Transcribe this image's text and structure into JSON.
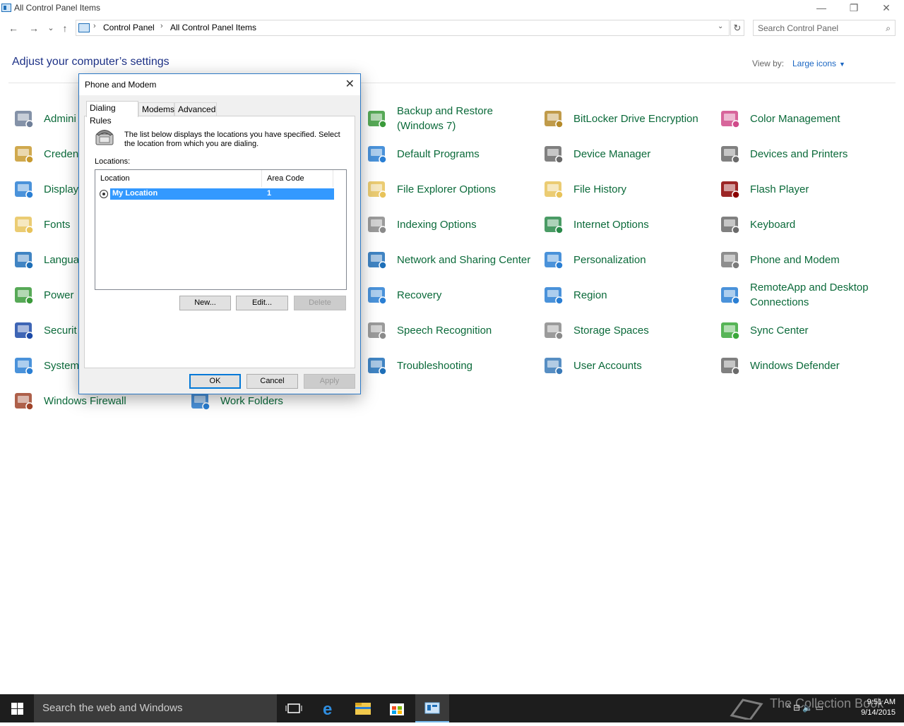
{
  "window": {
    "title": "All Control Panel Items",
    "min_glyph": "—",
    "restore_glyph": "❐",
    "close_glyph": "✕"
  },
  "nav": {
    "back_glyph": "←",
    "forward_glyph": "→",
    "recent_glyph": "⌄",
    "up_glyph": "↑",
    "sep_glyph": "›",
    "dropdown_glyph": "⌄",
    "refresh_glyph": "↻",
    "breadcrumb": [
      "Control Panel",
      "All Control Panel Items"
    ],
    "search_placeholder": "Search Control Panel",
    "search_glyph": "⌕"
  },
  "header": {
    "title": "Adjust your computer’s settings",
    "view_by_label": "View by:",
    "view_by_value": "Large icons",
    "view_by_caret": "▼"
  },
  "items": [
    {
      "label": "Admini",
      "icon": "administrative-tools-icon",
      "color": "#6f7f99"
    },
    {
      "label": "Creden",
      "icon": "credential-manager-icon",
      "color": "#c89a2f"
    },
    {
      "label": "Display",
      "icon": "display-icon",
      "color": "#2a7fd4"
    },
    {
      "label": "Fonts",
      "icon": "fonts-icon",
      "color": "#e8c35a"
    },
    {
      "label": "Langua",
      "icon": "language-icon",
      "color": "#1e6fb8"
    },
    {
      "label": "Power",
      "icon": "power-options-icon",
      "color": "#3a9a3a"
    },
    {
      "label": "Securit",
      "icon": "security-maintenance-icon",
      "color": "#1c4aa8"
    },
    {
      "label": "System",
      "icon": "system-icon",
      "color": "#2a7fd4"
    },
    {
      "label": "Windows Firewall",
      "icon": "firewall-icon",
      "color": "#a0442a"
    },
    {
      "label": "Work Folders",
      "icon": "work-folders-icon",
      "color": "#2a7fd4"
    },
    {
      "label": "Backup and Restore (Windows 7)",
      "icon": "backup-restore-icon",
      "color": "#3a9a3a"
    },
    {
      "label": "Default Programs",
      "icon": "default-programs-icon",
      "color": "#2a7fd4"
    },
    {
      "label": "File Explorer Options",
      "icon": "file-explorer-options-icon",
      "color": "#e8c35a"
    },
    {
      "label": "Indexing Options",
      "icon": "indexing-options-icon",
      "color": "#8a8a8a"
    },
    {
      "label": "Network and Sharing Center",
      "icon": "network-sharing-icon",
      "color": "#1e6fb8"
    },
    {
      "label": "Recovery",
      "icon": "recovery-icon",
      "color": "#2a7fd4"
    },
    {
      "label": "Speech Recognition",
      "icon": "microphone-icon",
      "color": "#8a8a8a"
    },
    {
      "label": "Troubleshooting",
      "icon": "troubleshooting-icon",
      "color": "#1e6fb8"
    },
    {
      "label": "BitLocker Drive Encryption",
      "icon": "bitlocker-icon",
      "color": "#b58a2a"
    },
    {
      "label": "Device Manager",
      "icon": "device-manager-icon",
      "color": "#6a6a6a"
    },
    {
      "label": "File History",
      "icon": "file-history-icon",
      "color": "#e8c35a"
    },
    {
      "label": "Internet Options",
      "icon": "internet-options-icon",
      "color": "#2a8a4a"
    },
    {
      "label": "Personalization",
      "icon": "personalization-icon",
      "color": "#2a7fd4"
    },
    {
      "label": "Region",
      "icon": "region-icon",
      "color": "#2a7fd4"
    },
    {
      "label": "Storage Spaces",
      "icon": "storage-spaces-icon",
      "color": "#8a8a8a"
    },
    {
      "label": "User Accounts",
      "icon": "user-accounts-icon",
      "color": "#3a7ab8"
    },
    {
      "label": "Color Management",
      "icon": "color-management-icon",
      "color": "#d04a8a"
    },
    {
      "label": "Devices and Printers",
      "icon": "devices-printers-icon",
      "color": "#6a6a6a"
    },
    {
      "label": "Flash Player",
      "icon": "flash-player-icon",
      "color": "#8b0000"
    },
    {
      "label": "Keyboard",
      "icon": "keyboard-icon",
      "color": "#6a6a6a"
    },
    {
      "label": "Phone and Modem",
      "icon": "phone-modem-icon",
      "color": "#7a7a7a"
    },
    {
      "label": "RemoteApp and Desktop Connections",
      "icon": "remoteapp-icon",
      "color": "#2a7fd4"
    },
    {
      "label": "Sync Center",
      "icon": "sync-center-icon",
      "color": "#3aa83a"
    },
    {
      "label": "Windows Defender",
      "icon": "windows-defender-icon",
      "color": "#6a6a6a"
    }
  ],
  "dialog": {
    "title": "Phone and Modem",
    "close_glyph": "✕",
    "tabs": [
      "Dialing Rules",
      "Modems",
      "Advanced"
    ],
    "description": "The list below displays the locations you have specified. Select the location from which you are dialing.",
    "locations_label": "Locations:",
    "columns": [
      "Location",
      "Area Code"
    ],
    "rows": [
      {
        "location": "My Location",
        "area_code": "1"
      }
    ],
    "buttons": {
      "new": "New...",
      "edit": "Edit...",
      "delete": "Delete",
      "ok": "OK",
      "cancel": "Cancel",
      "apply": "Apply"
    }
  },
  "taskbar": {
    "search_text": "Search the web and Windows",
    "tray_glyphs": "^  ⊟  🔈  ▭",
    "time": "9:51 AM",
    "date": "9/14/2015",
    "watermark": "The Collection Book"
  }
}
